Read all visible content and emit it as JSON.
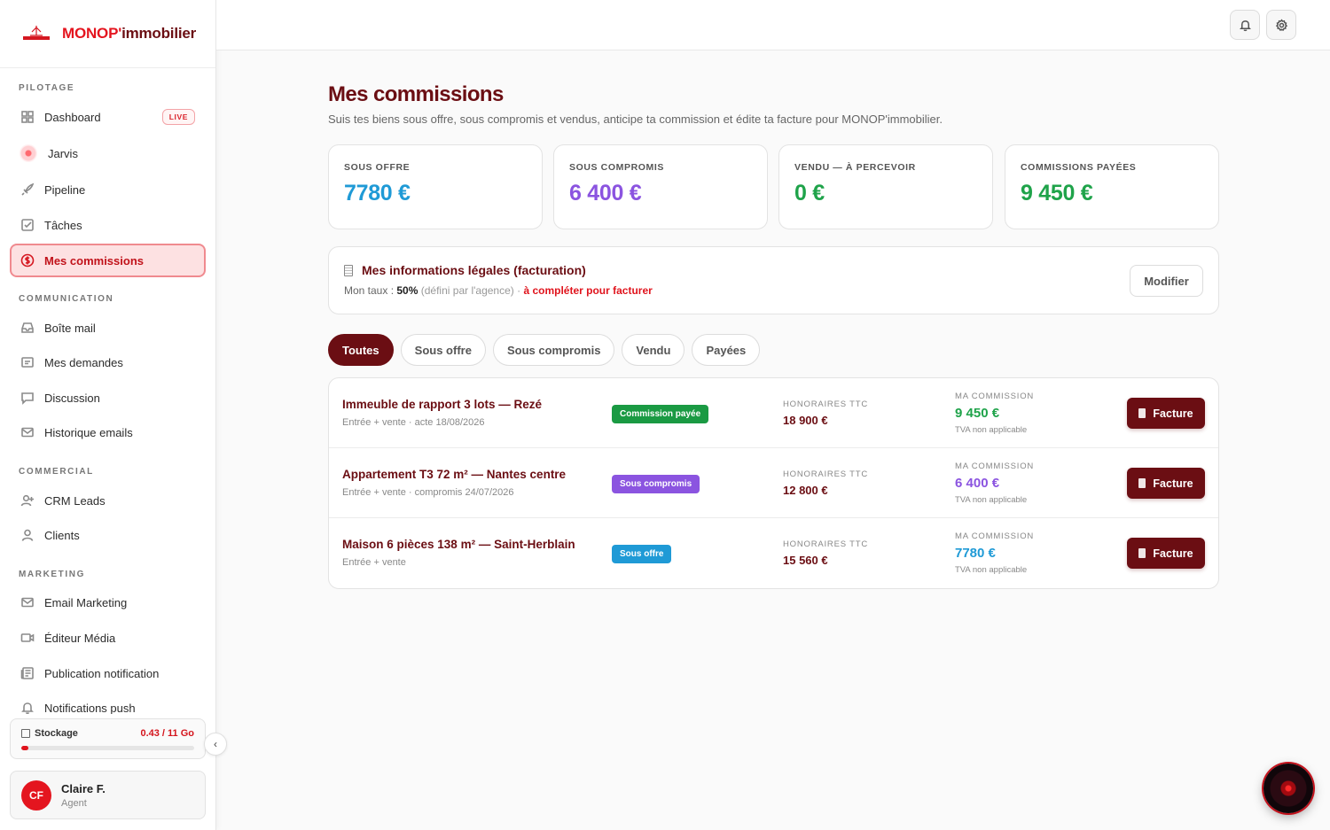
{
  "brand": {
    "name_part1": "MONOP'",
    "name_part2": "immobilier"
  },
  "sidebar": {
    "sections": [
      {
        "title": "PILOTAGE"
      },
      {
        "title": "COMMUNICATION"
      },
      {
        "title": "COMMERCIAL"
      },
      {
        "title": "MARKETING"
      }
    ],
    "items": [
      {
        "label": "Dashboard",
        "icon": "grid-icon",
        "badge": "LIVE"
      },
      {
        "label": "Jarvis",
        "icon": "jarvis-orb-icon"
      },
      {
        "label": "Pipeline",
        "icon": "rocket-icon"
      },
      {
        "label": "Tâches",
        "icon": "checkbox-icon"
      },
      {
        "label": "Mes commissions",
        "icon": "dollar-circle-icon",
        "active": true
      },
      {
        "label": "Boîte mail",
        "icon": "inbox-icon"
      },
      {
        "label": "Mes demandes",
        "icon": "message-square-icon"
      },
      {
        "label": "Discussion",
        "icon": "chat-bubble-icon"
      },
      {
        "label": "Historique emails",
        "icon": "mail-icon"
      },
      {
        "label": "CRM Leads",
        "icon": "user-plus-icon"
      },
      {
        "label": "Clients",
        "icon": "user-icon"
      },
      {
        "label": "Email Marketing",
        "icon": "mail-icon"
      },
      {
        "label": "Éditeur Média",
        "icon": "video-icon"
      },
      {
        "label": "Publication notification",
        "icon": "newspaper-icon"
      },
      {
        "label": "Notifications push",
        "icon": "bell-icon"
      }
    ],
    "storage": {
      "label": "Stockage",
      "value": "0.43 / 11 Go",
      "used_fraction": 0.039
    },
    "collapse_icon": "chevron-left-icon",
    "user": {
      "initials": "CF",
      "name": "Claire F.",
      "role": "Agent"
    }
  },
  "topbar": {
    "icons": [
      "bell-icon",
      "gear-icon"
    ]
  },
  "page": {
    "title": "Mes commissions",
    "subtitle": "Suis tes biens sous offre, sous compromis et vendus, anticipe ta commission et édite ta facture pour MONOP'immobilier."
  },
  "stats": [
    {
      "label": "SOUS OFFRE",
      "value": "7780 €",
      "color": "#1f9ad6"
    },
    {
      "label": "SOUS COMPROMIS",
      "value": "6 400 €",
      "color": "#8b54e0"
    },
    {
      "label": "VENDU — À PERCEVOIR",
      "value": "0 €",
      "color": "#1fa34a"
    },
    {
      "label": "COMMISSIONS PAYÉES",
      "value": "9 450 €",
      "color": "#1fa34a"
    }
  ],
  "legal": {
    "title": "Mes informations légales (facturation)",
    "rate_prefix": "Mon taux : ",
    "rate": "50%",
    "rate_note": "(défini par l'agence) ·",
    "warning": "à compléter pour facturer",
    "modify_label": "Modifier"
  },
  "filters": [
    {
      "label": "Toutes",
      "active": true
    },
    {
      "label": "Sous offre"
    },
    {
      "label": "Sous compromis"
    },
    {
      "label": "Vendu"
    },
    {
      "label": "Payées"
    }
  ],
  "deals": [
    {
      "title": "Immeuble de rapport 3 lots — Rezé",
      "meta": "Entrée + vente · acte 18/08/2026",
      "status": "Commission payée",
      "status_color": "#1a9a43",
      "fees_label": "HONORAIRES TTC",
      "fees": "18 900 €",
      "commission_label": "MA COMMISSION",
      "commission": "9 450 €",
      "commission_color": "#1fa34a",
      "tva": "TVA non applicable",
      "invoice_label": "Facture"
    },
    {
      "title": "Appartement T3 72 m² — Nantes centre",
      "meta": "Entrée + vente · compromis 24/07/2026",
      "status": "Sous compromis",
      "status_color": "#8b54e0",
      "fees_label": "HONORAIRES TTC",
      "fees": "12 800 €",
      "commission_label": "MA COMMISSION",
      "commission": "6 400 €",
      "commission_color": "#8b54e0",
      "tva": "TVA non applicable",
      "invoice_label": "Facture"
    },
    {
      "title": "Maison 6 pièces 138 m² — Saint-Herblain",
      "meta": "Entrée + vente",
      "status": "Sous offre",
      "status_color": "#1f9ad6",
      "fees_label": "HONORAIRES TTC",
      "fees": "15 560 €",
      "commission_label": "MA COMMISSION",
      "commission": "7780 €",
      "commission_color": "#1f9ad6",
      "tva": "TVA non applicable",
      "invoice_label": "Facture"
    }
  ],
  "assistant_button": {
    "icon": "assistant-orb-icon"
  }
}
